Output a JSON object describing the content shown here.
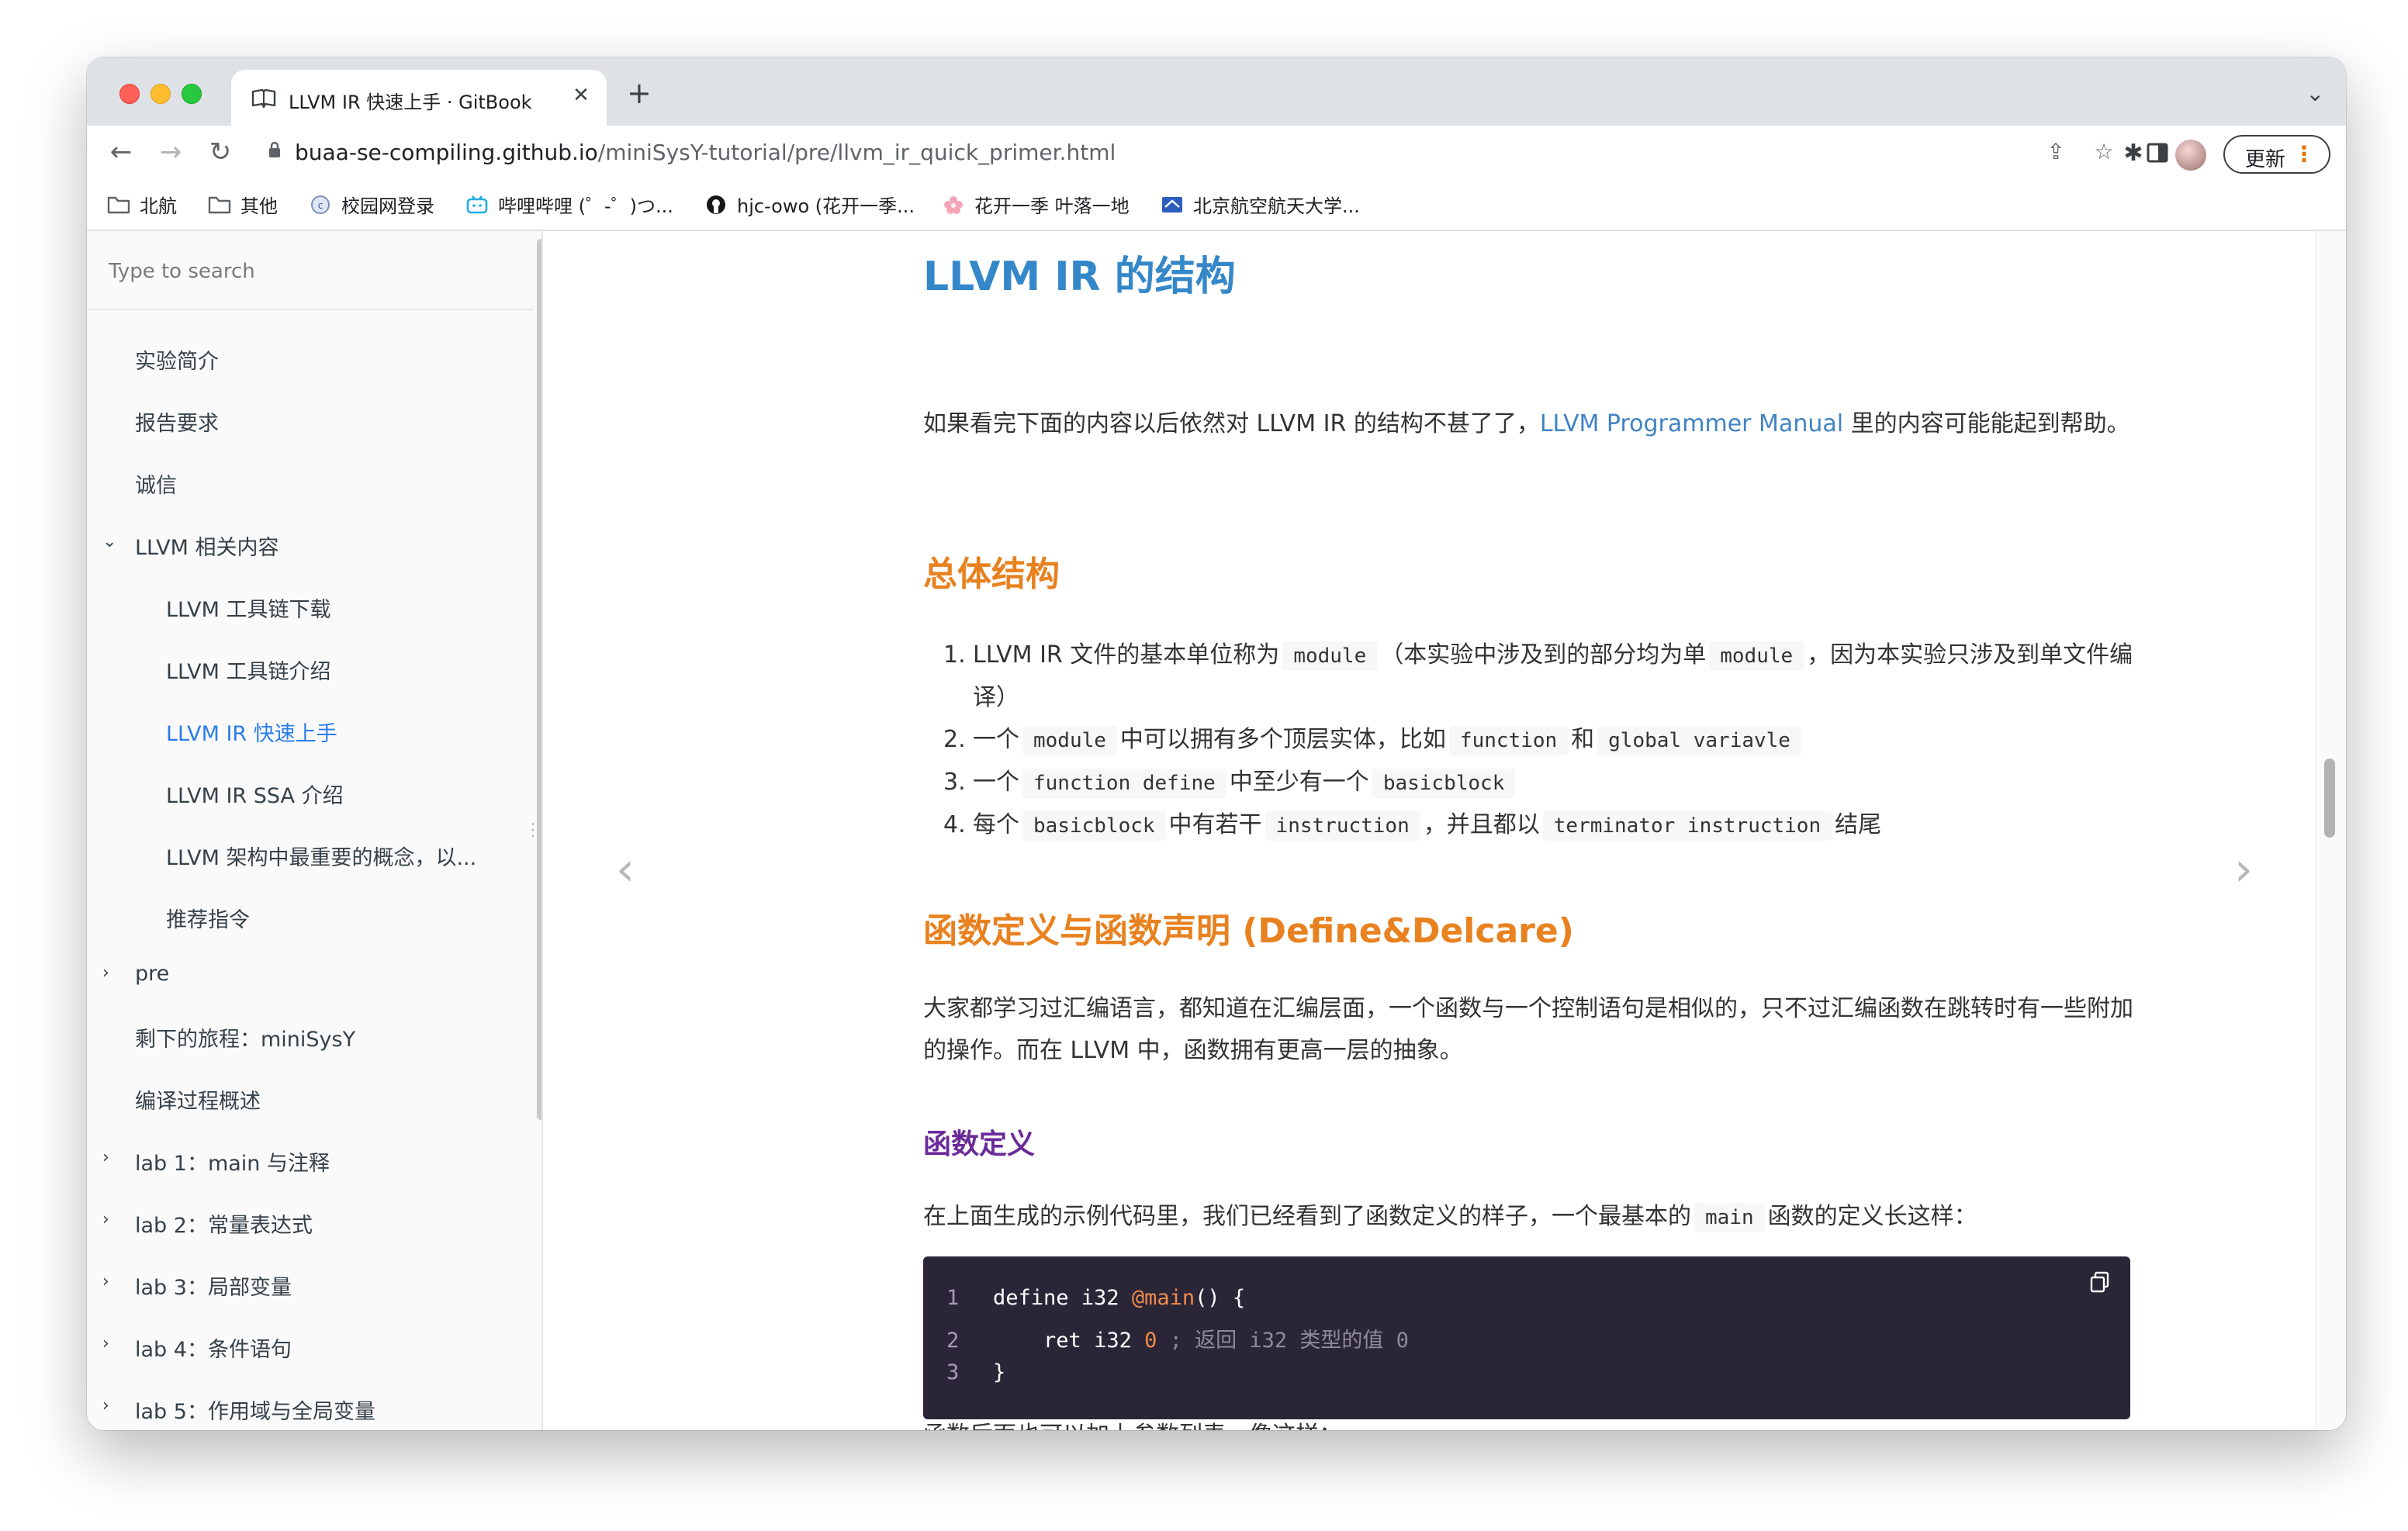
{
  "browser": {
    "tab": {
      "title": "LLVM IR 快速上手 · GitBook",
      "close": "✕"
    },
    "new_tab": "+",
    "tab_menu": "⌄",
    "url_host": "buaa-se-compiling.github.io",
    "url_path": "/miniSysY-tutorial/pre/llvm_ir_quick_primer.html",
    "update_label": "更新",
    "bookmarks": [
      {
        "label": "北航",
        "icon": "folder-icon"
      },
      {
        "label": "其他",
        "icon": "folder-icon"
      },
      {
        "label": "校园网登录",
        "icon": "campus-network-icon"
      },
      {
        "label": "哔哩哔哩 (゜-゜)つ...",
        "icon": "bilibili-icon"
      },
      {
        "label": "hjc-owo (花开一季...",
        "icon": "github-icon"
      },
      {
        "label": "花开一季 叶落一地",
        "icon": "flower-icon"
      },
      {
        "label": "北京航空航天大学...",
        "icon": "buaa-icon"
      }
    ]
  },
  "sidebar": {
    "search_placeholder": "Type to search",
    "items": [
      {
        "label": "实验简介"
      },
      {
        "label": "报告要求"
      },
      {
        "label": "诚信"
      },
      {
        "label": "LLVM 相关内容"
      },
      {
        "label": "LLVM 工具链下载"
      },
      {
        "label": "LLVM 工具链介绍"
      },
      {
        "label": "LLVM IR 快速上手"
      },
      {
        "label": "LLVM IR SSA 介绍"
      },
      {
        "label": "LLVM 架构中最重要的概念，以..."
      },
      {
        "label": "推荐指令"
      },
      {
        "label": "pre"
      },
      {
        "label": "剩下的旅程：miniSysY"
      },
      {
        "label": "编译过程概述"
      },
      {
        "label": "lab 1：main 与注释"
      },
      {
        "label": "lab 2：常量表达式"
      },
      {
        "label": "lab 3：局部变量"
      },
      {
        "label": "lab 4：条件语句"
      },
      {
        "label": "lab 5：作用域与全局变量"
      }
    ]
  },
  "article": {
    "h1": "LLVM IR 的结构",
    "intro_before": "如果看完下面的内容以后依然对 LLVM IR 的结构不甚了了，",
    "intro_link": "LLVM Programmer Manual",
    "intro_after": " 里的内容可能能起到帮助。",
    "h2_overall": "总体结构",
    "list": {
      "i1": {
        "num": "1.",
        "a": "LLVM IR 文件的基本单位称为",
        "c1": "module",
        "b": "（本实验中涉及到的部分均为单",
        "c2": "module",
        "d": "，因为本实验只涉及到单文件编译）"
      },
      "i2": {
        "num": "2.",
        "a": "一个",
        "c1": "module",
        "b": "中可以拥有多个顶层实体，比如",
        "c2": "function",
        "d": "和",
        "c3": "global variavle"
      },
      "i3": {
        "num": "3.",
        "a": "一个",
        "c1": "function define",
        "b": "中至少有一个",
        "c2": "basicblock"
      },
      "i4": {
        "num": "4.",
        "a": "每个",
        "c1": "basicblock",
        "b": "中有若干",
        "c2": "instruction",
        "d": "，并且都以",
        "c3": "terminator instruction",
        "e": "结尾"
      }
    },
    "h2_func": "函数定义与函数声明 (Define&Delcare)",
    "para_func": "大家都学习过汇编语言，都知道在汇编层面，一个函数与一个控制语句是相似的，只不过汇编函数在跳转时有一些附加的操作。而在 LLVM 中，函数拥有更高一层的抽象。",
    "h3_def": "函数定义",
    "para_def_before": "在上面生成的示例代码里，我们已经看到了函数定义的样子，一个最基本的",
    "para_def_code": "main",
    "para_def_after": "函数的定义长这样：",
    "code": {
      "l1": {
        "n": "1",
        "kw": "define",
        "ty": " i32 ",
        "fn": "@main",
        "rest": "() {"
      },
      "l2": {
        "n": "2",
        "indent": "    ",
        "kw": "ret",
        "ty": " i32 ",
        "num": "0",
        "cm": " ; 返回 i32 类型的值 0"
      },
      "l3": {
        "n": "3",
        "rest": "}"
      }
    },
    "para_params": "函数后面也可以加上参数列表，像这样："
  },
  "colors": {
    "h1": "#3487c9",
    "h2": "#e8811f",
    "h3": "#6b2b9a",
    "link": "#4183c4",
    "code_bg": "#2b2538",
    "active_nav": "#2b7de9"
  }
}
